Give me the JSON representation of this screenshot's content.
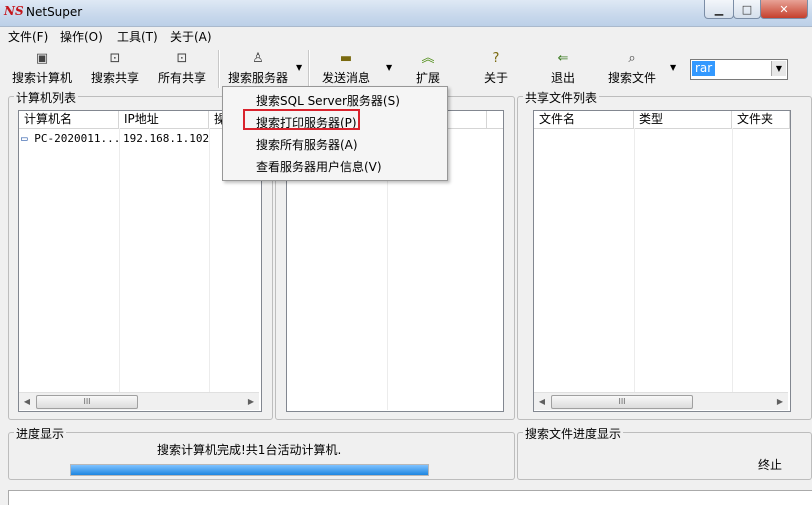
{
  "window": {
    "title": "NetSuper",
    "logo_text": "NS"
  },
  "window_buttons": {
    "minimize": "▁",
    "maximize": "□",
    "close": "✕"
  },
  "menubar": [
    "文件(F)",
    "操作(O)",
    "工具(T)",
    "关于(A)"
  ],
  "toolbar": {
    "search_computers": "搜索计算机",
    "search_shares": "搜索共享",
    "all_shares": "所有共享",
    "search_servers": "搜索服务器",
    "send_message": "发送消息",
    "extend": "扩展",
    "about": "关于",
    "exit": "退出",
    "search_files": "搜索文件",
    "file_type_value": "rar"
  },
  "computer_list": {
    "title": "计算机列表",
    "columns": [
      "计算机名",
      "IP地址",
      "操"
    ],
    "rows": [
      {
        "name": "PC-2020011...",
        "ip": "192.168.1.102"
      }
    ]
  },
  "shared_files": {
    "title": "共享文件列表",
    "columns": [
      "文件名",
      "类型",
      "文件夹"
    ]
  },
  "progress": {
    "title": "进度显示",
    "status_text": "搜索计算机完成!共1台活动计算机.",
    "fraction": 1.0
  },
  "file_progress": {
    "title": "搜索文件进度显示",
    "stop_label": "终止"
  },
  "server_menu": {
    "items": [
      "搜索SQL Server服务器(S)",
      "搜索打印服务器(P)",
      "搜索所有服务器(A)",
      "查看服务器用户信息(V)"
    ],
    "highlighted_index": 1
  },
  "scroll": {
    "left": "◀",
    "right": "▶",
    "thumb": "III"
  },
  "colors": {
    "progress": "#1e86e0",
    "highlight_border": "#d9232d",
    "selection": "#3399ff"
  }
}
